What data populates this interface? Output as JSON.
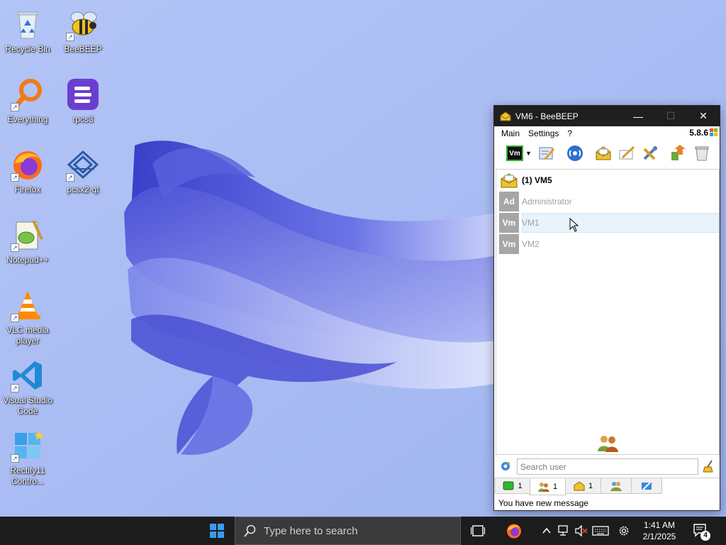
{
  "desktop": {
    "icons": [
      {
        "label": "Recycle Bin",
        "icon": "recycle-bin-icon"
      },
      {
        "label": "BeeBEEP",
        "icon": "bee-icon"
      },
      {
        "label": "Everything",
        "icon": "magnifier-icon"
      },
      {
        "label": "rpcs3",
        "icon": "rpcs3-icon"
      },
      {
        "label": "Firefox",
        "icon": "firefox-icon"
      },
      {
        "label": "pcsx2-qt",
        "icon": "pcsx2-icon"
      },
      {
        "label": "Notepad++",
        "icon": "notepadpp-icon"
      },
      {
        "label": "VLC media player",
        "icon": "vlc-icon"
      },
      {
        "label": "Visual Studio Code",
        "icon": "vscode-icon"
      },
      {
        "label": "Rectify11 Contro...",
        "icon": "rectify11-icon"
      }
    ]
  },
  "window": {
    "title": "VM6 - BeeBEEP",
    "controls": {
      "minimize": "—",
      "maximize": "☐",
      "close": "✕"
    },
    "menu": [
      "Main",
      "Settings",
      "?"
    ],
    "version": "5.8.6",
    "toolbar": {
      "status_label": "Vm",
      "icons": [
        "status-icon",
        "edit-profile-icon",
        "network-icon",
        "message-icon",
        "write-icon",
        "tools-icon",
        "share-icon",
        "trash-icon"
      ]
    },
    "users": [
      {
        "label": "(1) VM5",
        "type": "group",
        "avatar": ""
      },
      {
        "label": "Administrator",
        "type": "user",
        "avatar": "Ad"
      },
      {
        "label": "VM1",
        "type": "user",
        "avatar": "Vm"
      },
      {
        "label": "VM2",
        "type": "user",
        "avatar": "Vm"
      }
    ],
    "search": {
      "placeholder": "Search user",
      "value": ""
    },
    "tabs": [
      {
        "count": "1",
        "icon": "chat-tab-icon"
      },
      {
        "count": "1",
        "icon": "users-tab-icon"
      },
      {
        "count": "1",
        "icon": "groups-tab-icon"
      },
      {
        "count": "",
        "icon": "people-tab-icon"
      },
      {
        "count": "",
        "icon": "files-tab-icon"
      }
    ],
    "status": "You have new message"
  },
  "taskbar": {
    "search_placeholder": "Type here to search",
    "time": "1:41 AM",
    "date": "2/1/2025",
    "notification_count": "4"
  },
  "colors": {
    "wallpaper": "#a9bdf4",
    "taskbar": "#1c1c1c",
    "titlebar": "#1f1f1f",
    "avatar_gray": "#a6a6a6",
    "hover_blue": "#e8f3fc"
  }
}
